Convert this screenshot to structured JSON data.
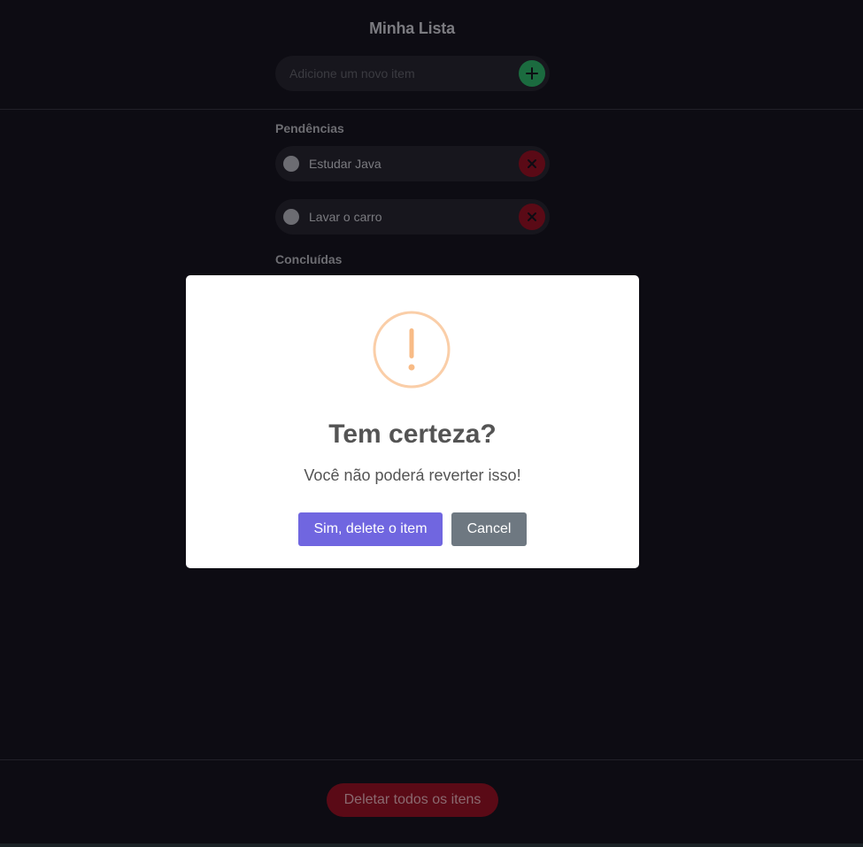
{
  "header": {
    "title": "Minha Lista",
    "add_placeholder": "Adicione um novo item"
  },
  "pending": {
    "title": "Pendências",
    "items": [
      {
        "label": "Estudar Java"
      },
      {
        "label": "Lavar o carro"
      }
    ]
  },
  "done": {
    "title": "Concluídas"
  },
  "footer": {
    "delete_all_label": "Deletar todos os itens"
  },
  "modal": {
    "icon": "warning-icon",
    "title": "Tem certeza?",
    "text": "Você não poderá reverter isso!",
    "confirm_label": "Sim, delete o item",
    "cancel_label": "Cancel"
  },
  "colors": {
    "background": "#0d0c13",
    "add_button": "#1b6b3f",
    "delete_button": "#5a0a16",
    "confirm_button": "#7066e0",
    "cancel_button": "#6e7881",
    "warning": "#facea8"
  }
}
